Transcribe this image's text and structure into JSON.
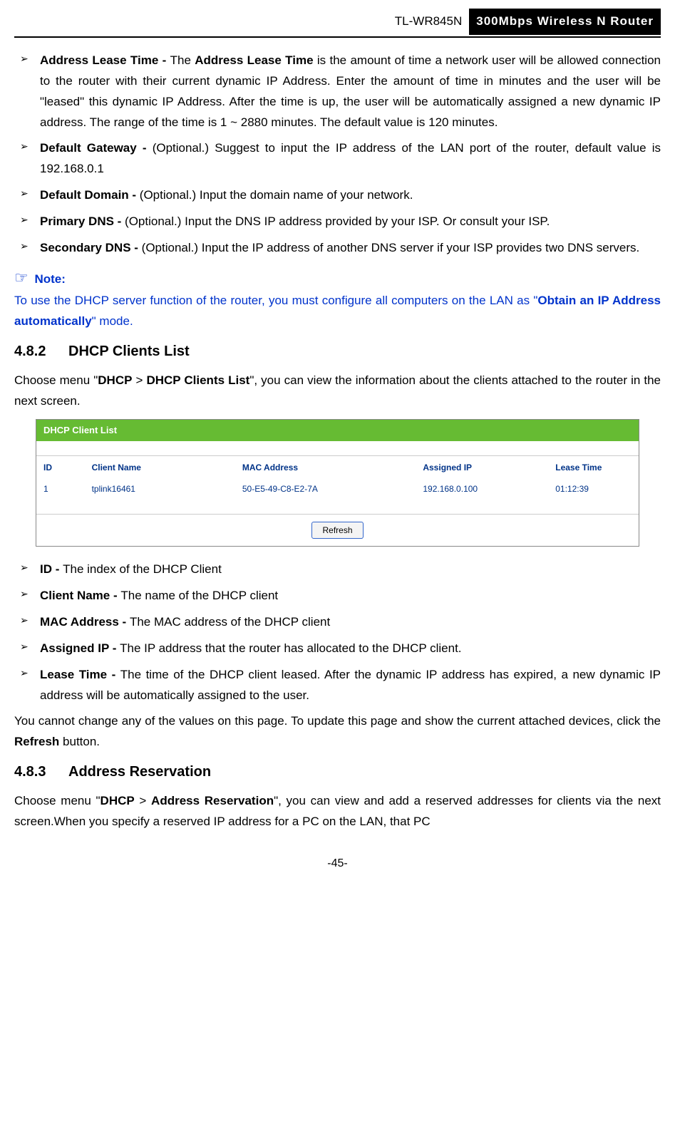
{
  "header": {
    "model": "TL-WR845N",
    "title": "300Mbps Wireless N Router"
  },
  "top_bullets": [
    {
      "label": "Address Lease Time - ",
      "strong2": "Address Lease Time",
      "pre2": "The ",
      "text": " is the amount of time a network user will be allowed connection to the router with their current dynamic IP Address. Enter the amount of time in minutes and the user will be \"leased\" this dynamic IP Address. After the time is up, the user will be automatically assigned a new dynamic IP address. The range of the time is 1 ~ 2880 minutes. The default value is 120 minutes."
    },
    {
      "label": "Default Gateway - ",
      "text": "(Optional.) Suggest to input the IP address of the LAN port of the router, default value is 192.168.0.1"
    },
    {
      "label": "Default Domain - ",
      "text": "(Optional.) Input the domain name of your network."
    },
    {
      "label": "Primary DNS - ",
      "text": "(Optional.) Input the DNS IP address provided by your ISP. Or consult your ISP."
    },
    {
      "label": "Secondary DNS - ",
      "text": "(Optional.) Input the IP address of another DNS server if your ISP provides two DNS servers."
    }
  ],
  "note": {
    "icon": "☞",
    "label": "Note:",
    "line_pre": "To use the DHCP server function of the router, you must configure all computers on the LAN as \"",
    "line_bold": "Obtain an IP Address automatically",
    "line_post": "\" mode."
  },
  "section1": {
    "num": "4.8.2",
    "title": "DHCP Clients List",
    "intro_pre": "Choose menu \"",
    "intro_b1": "DHCP",
    "intro_mid1": " > ",
    "intro_b2": "DHCP Clients List",
    "intro_post": "\", you can view the information about the clients attached to the router in the next screen."
  },
  "screenshot": {
    "titlebar": "DHCP Client List",
    "headers": {
      "id": "ID",
      "client": "Client Name",
      "mac": "MAC Address",
      "ip": "Assigned IP",
      "lease": "Lease Time"
    },
    "row": {
      "id": "1",
      "client": "tplink16461",
      "mac": "50-E5-49-C8-E2-7A",
      "ip": "192.168.0.100",
      "lease": "01:12:39"
    },
    "refresh": "Refresh"
  },
  "mid_bullets": [
    {
      "label": "ID - ",
      "text": "The index of the DHCP Client"
    },
    {
      "label": "Client Name - ",
      "text": "The name of the DHCP client"
    },
    {
      "label": "MAC Address - ",
      "text": "The MAC address of the DHCP client"
    },
    {
      "label": "Assigned IP - ",
      "text": "The IP address that the router has allocated to the DHCP client."
    },
    {
      "label": "Lease Time - ",
      "text": "The time of the DHCP client leased. After the dynamic IP address has expired, a new dynamic IP address will be automatically assigned to the user."
    }
  ],
  "post_list_pre": "You cannot change any of the values on this page. To update this page and show the current attached devices, click the ",
  "post_list_bold": "Refresh",
  "post_list_post": " button.",
  "section2": {
    "num": "4.8.3",
    "title": "Address Reservation",
    "intro_pre": "Choose menu \"",
    "intro_b1": "DHCP",
    "intro_mid1": " > ",
    "intro_b2": "Address Reservation",
    "intro_post": "\", you can view and add a reserved addresses for clients via the next screen.When you specify a reserved IP address for a PC on the LAN, that PC"
  },
  "page_num": "-45-"
}
